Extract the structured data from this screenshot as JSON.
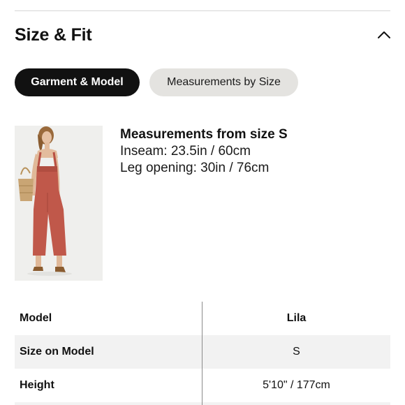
{
  "section": {
    "title": "Size & Fit",
    "toggle_icon": "chevron-up-icon"
  },
  "tabs": [
    {
      "label": "Garment & Model",
      "active": true
    },
    {
      "label": "Measurements by Size",
      "active": false
    }
  ],
  "product_image": {
    "icon": "product-photo-model-in-jumpsuit",
    "garment_color": "#c0584a"
  },
  "measurements": {
    "title": "Measurements from size S",
    "lines": [
      "Inseam: 23.5in / 60cm",
      "Leg opening: 30in / 76cm"
    ]
  },
  "model_table": {
    "rows": [
      {
        "label": "Model",
        "value": "Lila"
      },
      {
        "label": "Size on Model",
        "value": "S"
      },
      {
        "label": "Height",
        "value": "5'10\" / 177cm"
      }
    ]
  },
  "colors": {
    "accent": "#111111",
    "tab_inactive_bg": "#e4e3e0",
    "row_shade": "#f2f2f2",
    "divider": "#d6d6d6"
  }
}
